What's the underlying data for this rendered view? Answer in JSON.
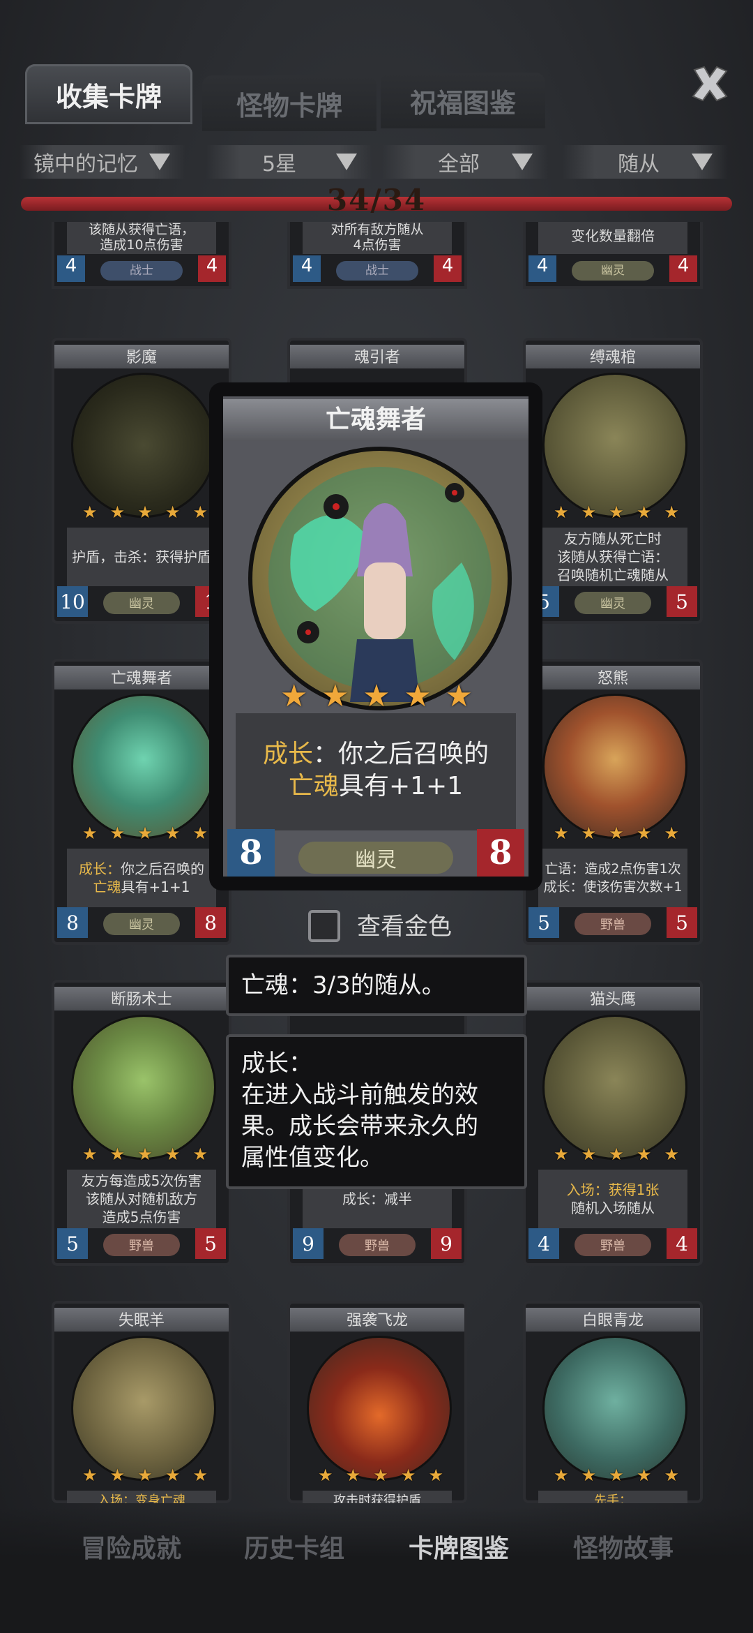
{
  "tabs": {
    "collect": "收集卡牌",
    "monster": "怪物卡牌",
    "blessing": "祝福图鉴"
  },
  "filters": {
    "expansion": "镜中的记忆",
    "stars": "5星",
    "race": "全部",
    "type": "随从"
  },
  "progress": {
    "text": "34/34",
    "fraction": 1.0
  },
  "colors": {
    "accent_gold": "#e8b94a",
    "hp_red": "#a5262c",
    "atk_blue": "#2d5a86"
  },
  "top_row": [
    {
      "desc_line1": "该随从获得亡语，",
      "desc_line2": "造成10点伤害",
      "atk": "4",
      "hp": "4",
      "type": "战士"
    },
    {
      "desc_line1": "对所有敌方随从",
      "desc_line2": "4点伤害",
      "atk": "4",
      "hp": "4",
      "type": "战士"
    },
    {
      "desc_line1": "变化数量翻倍",
      "desc_line2": "",
      "atk": "4",
      "hp": "4",
      "type": "幽灵"
    }
  ],
  "row2": [
    {
      "name": "影魔",
      "desc_a": "护盾，击杀：获得护盾",
      "atk": "10",
      "hp": "1",
      "type": "幽灵"
    },
    {
      "name": "魂引者",
      "atk": "",
      "hp": "",
      "type": ""
    },
    {
      "name": "缚魂棺",
      "desc_a": "友方随从死亡时",
      "desc_b": "该随从获得亡语：",
      "desc_c": "召唤随机亡魂随从",
      "atk": "5",
      "hp": "5",
      "type": "幽灵"
    }
  ],
  "row3": [
    {
      "name": "亡魂舞者",
      "desc_a": "成长：",
      "desc_b": "你之后召唤的",
      "desc_c": "亡魂",
      "desc_d": "具有+1+1",
      "atk": "8",
      "hp": "8",
      "type": "幽灵"
    },
    {
      "name": "怒熊",
      "desc_a": "亡语：造成2点伤害1次",
      "desc_b": "成长：使该伤害次数+1",
      "atk": "5",
      "hp": "5",
      "type": "野兽"
    }
  ],
  "row4": [
    {
      "name": "断肠术士",
      "desc_a": "友方每造成5次伤害",
      "desc_b": "该随从对随机敌方",
      "desc_c": "造成5点伤害",
      "atk": "5",
      "hp": "5",
      "type": "野兽"
    },
    {
      "name": "",
      "desc_a": "成长：减半",
      "atk": "9",
      "hp": "9",
      "type": "野兽"
    },
    {
      "name": "猫头鹰",
      "desc_a": "入场：获得1张",
      "desc_b": "随机入场随从",
      "atk": "4",
      "hp": "4",
      "type": "野兽"
    }
  ],
  "row5": [
    {
      "name": "失眠羊",
      "desc_a": "入场：变身亡魂"
    },
    {
      "name": "强袭飞龙",
      "desc_a": "攻击时获得护盾"
    },
    {
      "name": "白眼青龙",
      "desc_a": "先手："
    }
  ],
  "popup": {
    "name": "亡魂舞者",
    "desc_key": "成长",
    "desc_rest": "：你之后召唤的",
    "desc_key2": "亡魂",
    "desc_rest2": "具有+1+1",
    "atk": "8",
    "hp": "8",
    "type": "幽灵",
    "stars": 5
  },
  "gold_toggle": {
    "label": "查看金色",
    "checked": false
  },
  "tooltips": {
    "t1": "亡魂：3/3的随从。",
    "t2_title": "成长：",
    "t2_line1": "在进入战斗前触发的效",
    "t2_line2": "果。成长会带来永久的",
    "t2_line3": "属性值变化。"
  },
  "bottom_nav": {
    "a": "冒险成就",
    "b": "历史卡组",
    "c": "卡牌图鉴",
    "d": "怪物故事"
  }
}
